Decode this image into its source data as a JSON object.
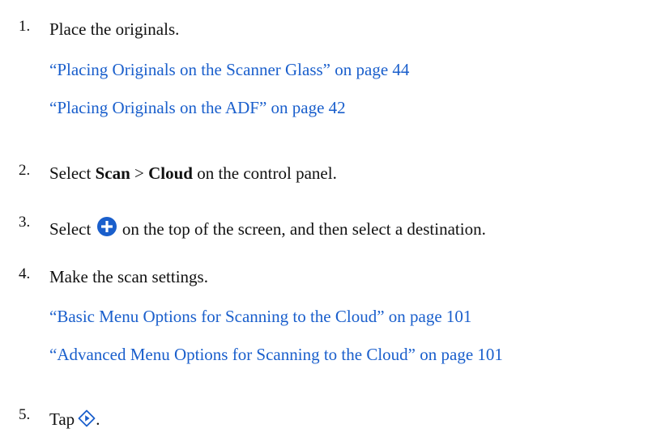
{
  "steps": [
    {
      "number": "1.",
      "text": "Place the originals.",
      "links": [
        "“Placing Originals on the Scanner Glass” on page 44",
        "“Placing Originals on the ADF” on page 42"
      ]
    },
    {
      "number": "2.",
      "select_word": "Select",
      "scan": "Scan",
      "arrow": ">",
      "cloud": "Cloud",
      "tail": "on the control panel."
    },
    {
      "number": "3.",
      "select_word": "Select",
      "icon": "plus-circle-icon",
      "tail": "on the top of the screen, and then select a destination."
    },
    {
      "number": "4.",
      "text": "Make the scan settings.",
      "links": [
        "“Basic Menu Options for Scanning to the Cloud” on page 101",
        "“Advanced Menu Options for Scanning to the Cloud” on page 101"
      ]
    },
    {
      "number": "5.",
      "tap_word": "Tap",
      "icon": "start-diamond-icon",
      "period": "."
    }
  ],
  "colors": {
    "link": "#1a5fcc",
    "icon": "#1a5fcc",
    "text": "#111111"
  }
}
